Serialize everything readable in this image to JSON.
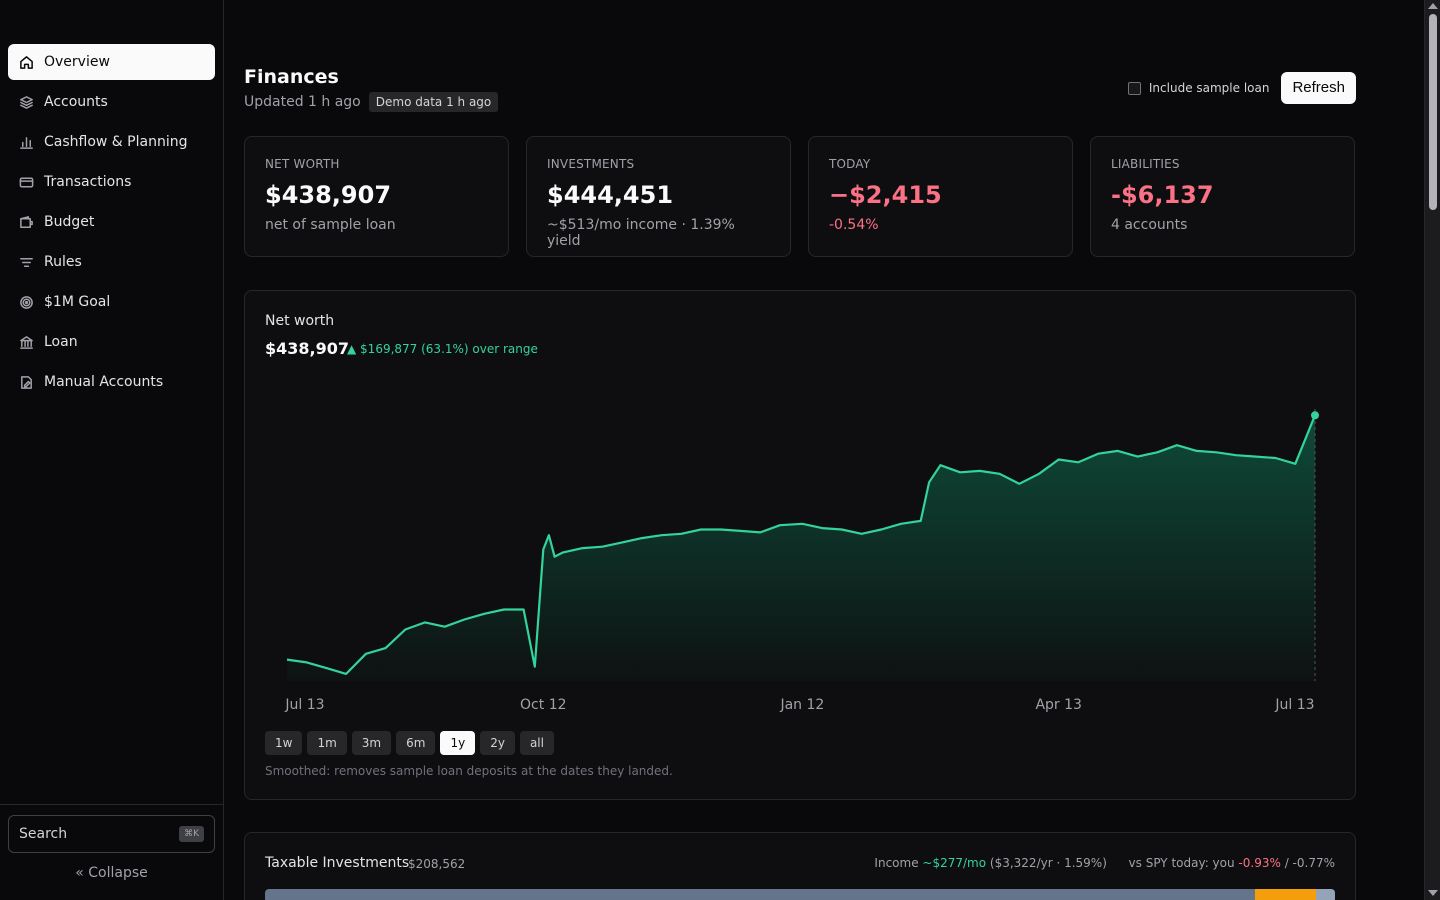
{
  "sidebar": {
    "items": [
      {
        "label": "Overview",
        "icon": "home-icon"
      },
      {
        "label": "Accounts",
        "icon": "layers-icon"
      },
      {
        "label": "Cashflow & Planning",
        "icon": "bar-chart-icon"
      },
      {
        "label": "Transactions",
        "icon": "credit-card-icon"
      },
      {
        "label": "Budget",
        "icon": "wallet-icon"
      },
      {
        "label": "Rules",
        "icon": "filter-icon"
      },
      {
        "label": "$1M Goal",
        "icon": "target-icon"
      },
      {
        "label": "Loan",
        "icon": "bank-icon"
      },
      {
        "label": "Manual Accounts",
        "icon": "file-edit-icon"
      }
    ],
    "search_label": "Search",
    "search_shortcut": "⌘K",
    "collapse_label": "« Collapse"
  },
  "header": {
    "title": "Finances",
    "updated": "Updated 1 h ago",
    "badge": "Demo data 1 h ago",
    "include_loan_label": "Include sample loan",
    "include_loan_checked": false,
    "refresh_label": "Refresh"
  },
  "cards": [
    {
      "label": "NET WORTH",
      "value": "$438,907",
      "sub": "net of sample loan",
      "negative": false,
      "sub_negative": false
    },
    {
      "label": "INVESTMENTS",
      "value": "$444,451",
      "sub": "~$513/mo income · 1.39% yield",
      "negative": false,
      "sub_negative": false
    },
    {
      "label": "TODAY",
      "value": "−$2,415",
      "sub": "-0.54%",
      "negative": true,
      "sub_negative": true
    },
    {
      "label": "LIABILITIES",
      "value": "-$6,137",
      "sub": "4 accounts",
      "negative": true,
      "sub_negative": false
    }
  ],
  "net_worth_chart": {
    "title": "Net worth",
    "value": "$438,907",
    "change": "▲ $169,877 (63.1%) over range",
    "ranges": [
      "1w",
      "1m",
      "3m",
      "6m",
      "1y",
      "2y",
      "all"
    ],
    "active_range": "1y",
    "note": "Smoothed: removes sample loan deposits at the dates they landed.",
    "line_color": "#34d399"
  },
  "chart_data": {
    "type": "area",
    "title": "Net worth",
    "x_tick_labels": [
      "Jul 13",
      "Oct 12",
      "Jan 12",
      "Apr 13",
      "Jul 13"
    ],
    "x": [
      "2024-07-13",
      "2024-07-20",
      "2024-07-27",
      "2024-08-03",
      "2024-08-10",
      "2024-08-17",
      "2024-08-24",
      "2024-08-31",
      "2024-09-07",
      "2024-09-14",
      "2024-09-21",
      "2024-09-28",
      "2024-10-05",
      "2024-10-09",
      "2024-10-12",
      "2024-10-14",
      "2024-10-16",
      "2024-10-19",
      "2024-10-26",
      "2024-11-02",
      "2024-11-09",
      "2024-11-16",
      "2024-11-23",
      "2024-11-30",
      "2024-12-07",
      "2024-12-14",
      "2024-12-21",
      "2024-12-28",
      "2025-01-04",
      "2025-01-12",
      "2025-01-19",
      "2025-01-26",
      "2025-02-02",
      "2025-02-09",
      "2025-02-16",
      "2025-02-23",
      "2025-02-26",
      "2025-03-02",
      "2025-03-09",
      "2025-03-16",
      "2025-03-23",
      "2025-03-30",
      "2025-04-06",
      "2025-04-13",
      "2025-04-20",
      "2025-04-27",
      "2025-05-04",
      "2025-05-11",
      "2025-05-18",
      "2025-05-25",
      "2025-06-01",
      "2025-06-08",
      "2025-06-15",
      "2025-06-22",
      "2025-06-29",
      "2025-07-06",
      "2025-07-13"
    ],
    "values": [
      268000,
      266000,
      262000,
      258000,
      272000,
      276000,
      289000,
      294000,
      291000,
      296000,
      300000,
      303000,
      303000,
      263000,
      345000,
      355000,
      340000,
      343000,
      346000,
      347000,
      350000,
      353000,
      355000,
      356000,
      359000,
      359000,
      358000,
      357000,
      362000,
      363000,
      360000,
      359000,
      356000,
      359000,
      363000,
      365000,
      392000,
      404000,
      399000,
      400000,
      398000,
      391000,
      398000,
      408000,
      406000,
      412000,
      414000,
      410000,
      413000,
      418000,
      414000,
      413000,
      411000,
      410000,
      409000,
      405000,
      438907
    ],
    "ylabel": "",
    "xlabel": ""
  },
  "taxable": {
    "title": "Taxable Investments",
    "amount": "$208,562",
    "income_prefix": "Income ",
    "income_value": "~$277/mo",
    "income_detail": " ($3,322/yr · 1.59%)",
    "spy_prefix": "vs SPY today: you ",
    "spy_you": "-0.93%",
    "spy_suffix": " / -0.77%",
    "bar_segments": [
      0.925,
      0.057,
      0.018
    ],
    "colors": {
      "main": "#64748b",
      "orange": "#f59e0b",
      "tail": "#94a3b8"
    }
  }
}
